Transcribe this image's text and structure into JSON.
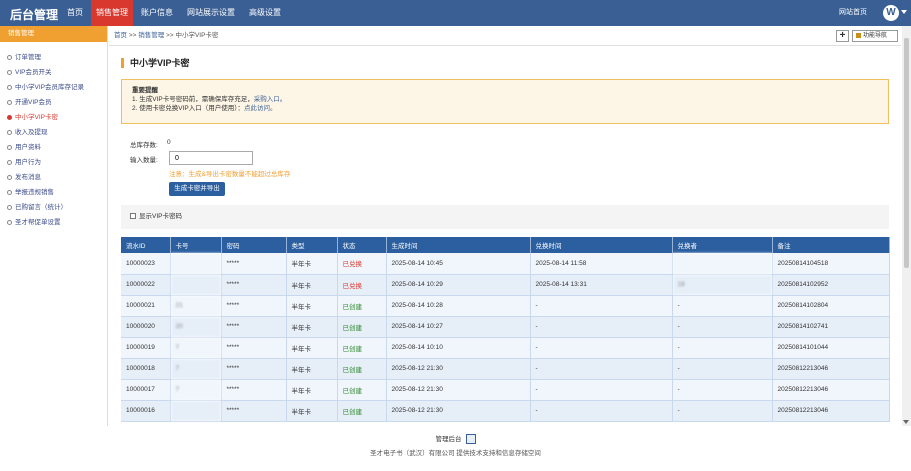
{
  "topbar": {
    "brand": "后台管理",
    "nav": [
      "首页",
      "销售管理",
      "账户信息",
      "网站展示设置",
      "高级设置"
    ],
    "site_home": "网站首页",
    "avatar_letter": "W"
  },
  "sidebar": {
    "header": "销售管理",
    "items": [
      "订单管理",
      "VIP会员开关",
      "中小学VIP会员库存记录",
      "开通VIP会员",
      "中小学VIP卡密",
      "收入及提现",
      "用户资料",
      "用户行为",
      "发布消息",
      "举报违规销售",
      "已购留言（统计）",
      "圣才帮促单设置"
    ]
  },
  "breadcrumb": {
    "home": "首页",
    "sep1": ">>",
    "section": "销售管理",
    "sep2": ">>",
    "current": "中小学VIP卡密"
  },
  "toolbar": {
    "plus": "+",
    "nav_label": "功能导航"
  },
  "page": {
    "title": "中小学VIP卡密",
    "notice_title": "重要提醒",
    "notice_line1_pre": "1. 生成VIP卡号密码前，需确保库存充足，",
    "notice_line1_link": "采购入口。",
    "notice_line2_pre": "2. 使用卡密兑换VIP入口（用户使用）：",
    "notice_line2_link": "点此访问。",
    "stock_label": "总库存数:",
    "stock_value": "0",
    "qty_label": "输入数量:",
    "qty_value": "0",
    "qty_note": "注意：生成&导出卡密数量不能超过总库存",
    "gen_button": "生成卡密并导出",
    "show_toggle": "显示VIP卡密码"
  },
  "table": {
    "headers": [
      "流水ID",
      "卡号",
      "密码",
      "类型",
      "状态",
      "生成时间",
      "兑换时间",
      "兑换者",
      "备注"
    ],
    "rows": [
      {
        "id": "10000023",
        "card": "",
        "pwd": "*****",
        "type": "半年卡",
        "status": "已兑换",
        "created": "2025-08-14 10:45",
        "redeemed": "2025-08-14 11:58",
        "user": "",
        "note": "20250814104518"
      },
      {
        "id": "10000022",
        "card": "",
        "pwd": "*****",
        "type": "半年卡",
        "status": "已兑换",
        "created": "2025-08-14 10:29",
        "redeemed": "2025-08-14 13:31",
        "user": "18",
        "note": "20250814102952"
      },
      {
        "id": "10000021",
        "card": "21",
        "pwd": "*****",
        "type": "半年卡",
        "status": "已创建",
        "created": "2025-08-14 10:28",
        "redeemed": "-",
        "user": "-",
        "note": "20250814102804"
      },
      {
        "id": "10000020",
        "card": "20",
        "pwd": "*****",
        "type": "半年卡",
        "status": "已创建",
        "created": "2025-08-14 10:27",
        "redeemed": "-",
        "user": "-",
        "note": "20250814102741"
      },
      {
        "id": "10000019",
        "card": "7",
        "pwd": "*****",
        "type": "半年卡",
        "status": "已创建",
        "created": "2025-08-14 10:10",
        "redeemed": "-",
        "user": "-",
        "note": "20250814101044"
      },
      {
        "id": "10000018",
        "card": "7",
        "pwd": "*****",
        "type": "半年卡",
        "status": "已创建",
        "created": "2025-08-12 21:30",
        "redeemed": "-",
        "user": "-",
        "note": "20250812213046"
      },
      {
        "id": "10000017",
        "card": "7",
        "pwd": "*****",
        "type": "半年卡",
        "status": "已创建",
        "created": "2025-08-12 21:30",
        "redeemed": "-",
        "user": "-",
        "note": "20250812213046"
      },
      {
        "id": "10000016",
        "card": "",
        "pwd": "*****",
        "type": "半年卡",
        "status": "已创建",
        "created": "2025-08-12 21:30",
        "redeemed": "-",
        "user": "-",
        "note": "20250812213046"
      }
    ]
  },
  "footer": {
    "line1": "管理后台",
    "line2": "圣才电子书（武汉）有限公司 提供技术支持和信息存储空间"
  },
  "colors": {
    "topbar": "#3a5f94",
    "active_nav": "#d9382e",
    "sidebar_header": "#f0a030",
    "table_header": "#2b5fa0",
    "status_redeemed": "#d9382e",
    "status_created": "#2e8b2e"
  }
}
